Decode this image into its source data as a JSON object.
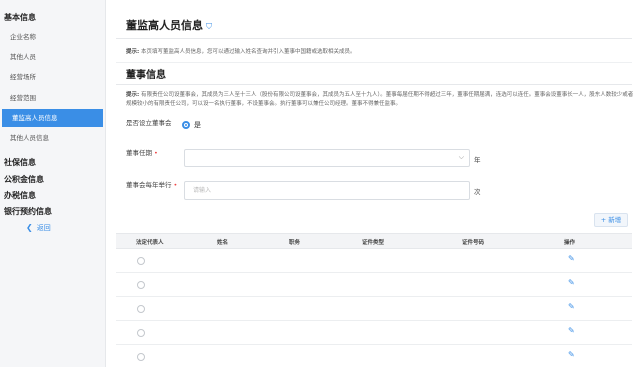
{
  "sidebar": {
    "section1": "基本信息",
    "items": [
      "企业名称",
      "其他人员",
      "经营场所",
      "经营范围",
      "董监高人员信息",
      "其他人员信息"
    ],
    "section2": [
      "社保信息",
      "公积金信息",
      "办税信息",
      "银行预约信息"
    ],
    "back": "返回"
  },
  "main": {
    "title": "董监高人员信息",
    "hint_top_label": "提示:",
    "hint_top": "本页填写董监高人员信息，您可以通过输入姓名查询并引入董事中国籍或选取相关成员。",
    "section_title": "董事信息",
    "hint_label": "提示:",
    "hint": "有限责任公司设董事会，其成员为三人至十三人（股份有限公司设董事会，其成员为五人至十九人）。董事每届任期不得超过三年，董事任期届满，连选可以连任。董事会设董事长一人，股东人数较少或者规模较小的有限责任公司，可以设一名执行董事，不设董事会。执行董事可以兼任公司经理。董事不得兼任监事。",
    "board_label": "是否设立董事会",
    "board_value": "是",
    "term_label": "董事任期",
    "term_unit": "年",
    "meetings_label": "董事会每年举行",
    "meetings_placeholder": "请输入",
    "meetings_unit": "次",
    "add_button": "+ 新增"
  },
  "table": {
    "headers": [
      "法定代表人",
      "姓名",
      "职务",
      "证件类型",
      "证件号码",
      "操作"
    ],
    "rows": 5
  },
  "colors": {
    "accent": "#3a8ee6",
    "required": "#e44444"
  }
}
